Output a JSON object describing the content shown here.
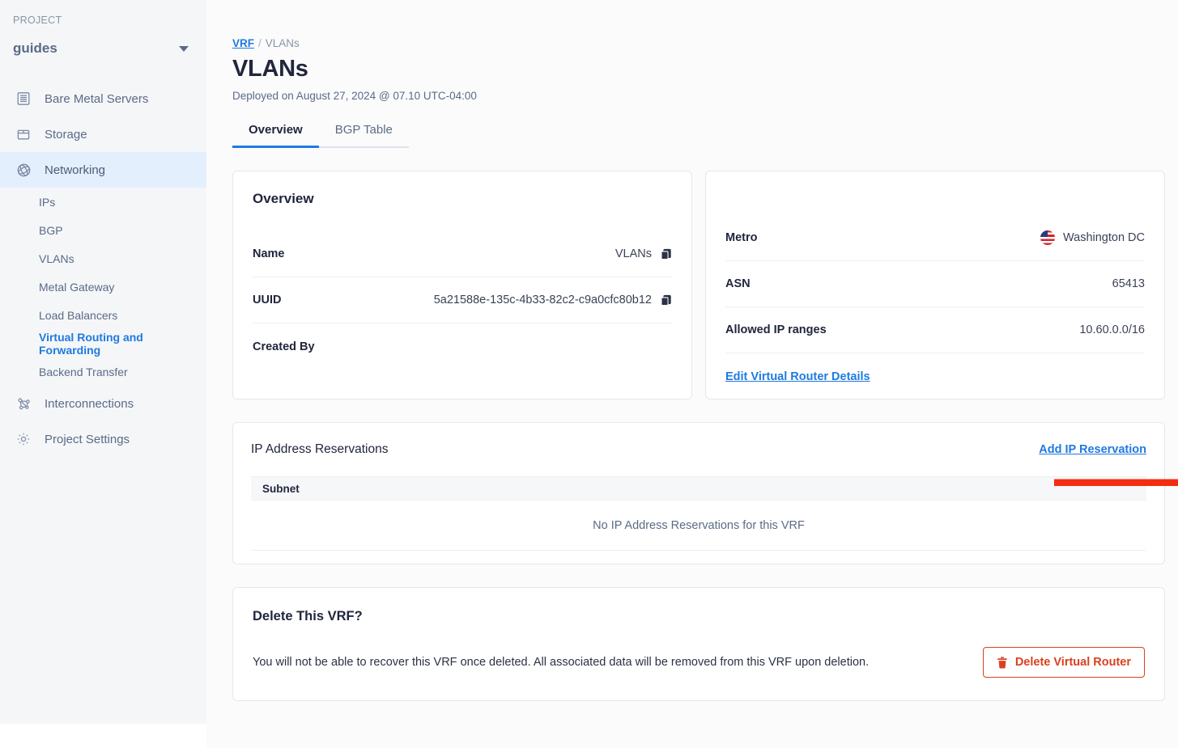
{
  "sidebar": {
    "project_label": "PROJECT",
    "project_name": "guides",
    "caret_icon": "chevron-down-icon",
    "items": [
      {
        "label": "Bare Metal Servers",
        "icon": "server-icon"
      },
      {
        "label": "Storage",
        "icon": "storage-box-icon"
      },
      {
        "label": "Networking",
        "icon": "globe-network-icon",
        "active": true
      },
      {
        "label": "Interconnections",
        "icon": "network-graph-icon"
      },
      {
        "label": "Project Settings",
        "icon": "gear-icon"
      }
    ],
    "sub_items": [
      {
        "label": "IPs"
      },
      {
        "label": "BGP"
      },
      {
        "label": "VLANs"
      },
      {
        "label": "Metal Gateway"
      },
      {
        "label": "Load Balancers"
      },
      {
        "label": "Virtual Routing and Forwarding",
        "current": true
      },
      {
        "label": "Backend Transfer"
      }
    ]
  },
  "header": {
    "breadcrumb_root": "VRF",
    "breadcrumb_sep": "/",
    "breadcrumb_current": "VLANs",
    "title": "VLANs",
    "deployed": "Deployed on August 27, 2024 @ 07.10 UTC-04:00"
  },
  "tabs": [
    {
      "label": "Overview",
      "active": true
    },
    {
      "label": "BGP Table",
      "active": false
    }
  ],
  "overview_card": {
    "title": "Overview",
    "rows": [
      {
        "key": "Name",
        "value": "VLANs",
        "copy": true
      },
      {
        "key": "UUID",
        "value": "5a21588e-135c-4b33-82c2-c9a0cfc80b12",
        "copy": true
      },
      {
        "key": "Created By",
        "value": "",
        "copy": false
      }
    ]
  },
  "details_card": {
    "rows": [
      {
        "key": "Metro",
        "value": "Washington DC",
        "flag": "us-flag-icon"
      },
      {
        "key": "ASN",
        "value": "65413"
      },
      {
        "key": "Allowed IP ranges",
        "value": "10.60.0.0/16"
      }
    ],
    "edit_link": "Edit Virtual Router Details"
  },
  "ip_reservations": {
    "title": "IP Address Reservations",
    "add_link": "Add IP Reservation",
    "column_header": "Subnet",
    "empty_message": "No IP Address Reservations for this VRF"
  },
  "delete_section": {
    "title": "Delete This VRF?",
    "description": "You will not be able to recover this VRF once deleted. All associated data will be removed from this VRF upon deletion.",
    "button_label": "Delete Virtual Router",
    "button_icon": "trash-icon"
  },
  "annotation": {
    "type": "arrow-right",
    "color": "#f42d10",
    "points_to": "Add IP Reservation"
  },
  "colors": {
    "accent_blue": "#1f7ae0",
    "danger_red": "#d9411e",
    "annotation_red": "#f42d10",
    "sidebar_bg": "#f4f6f8",
    "active_nav_bg": "#e3effc"
  }
}
